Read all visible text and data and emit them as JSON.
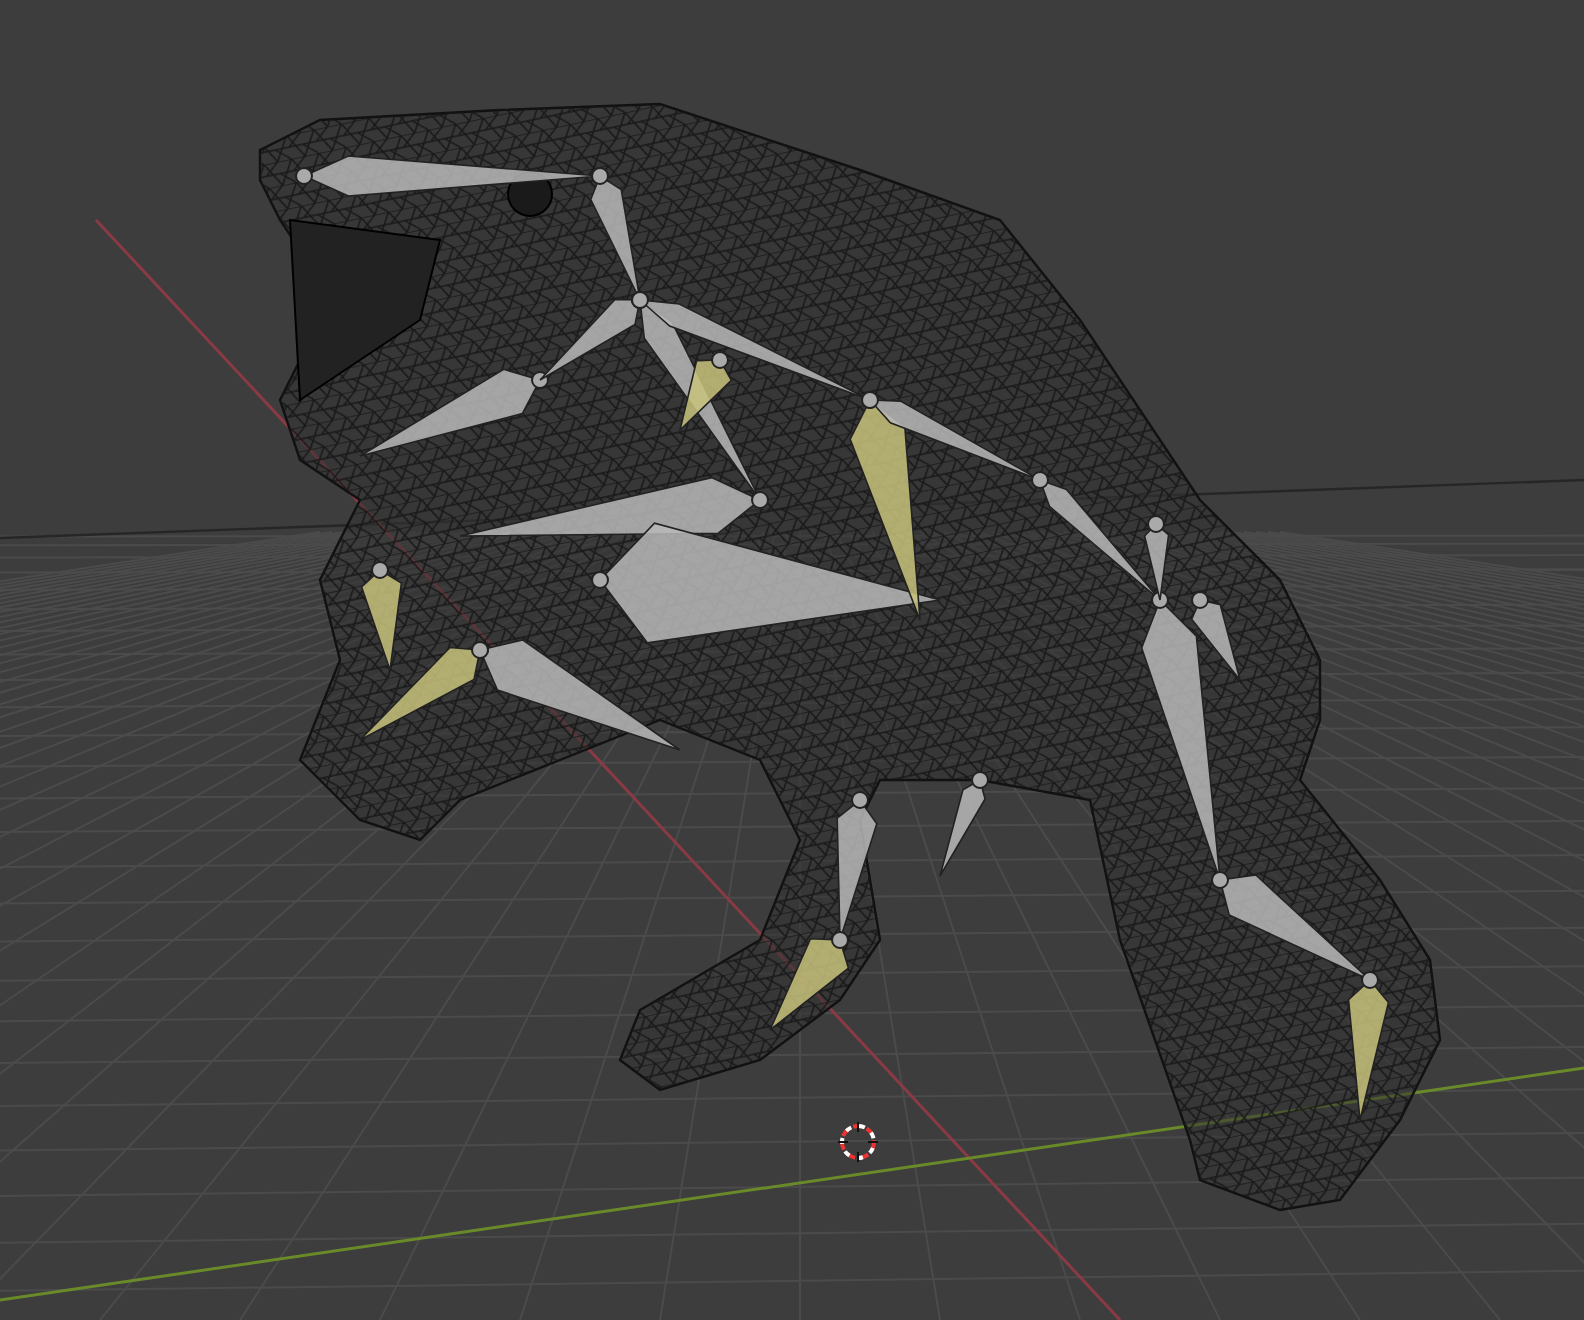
{
  "viewport": {
    "show_floor_grid": true,
    "show_axes": true,
    "show_cursor": true
  }
}
